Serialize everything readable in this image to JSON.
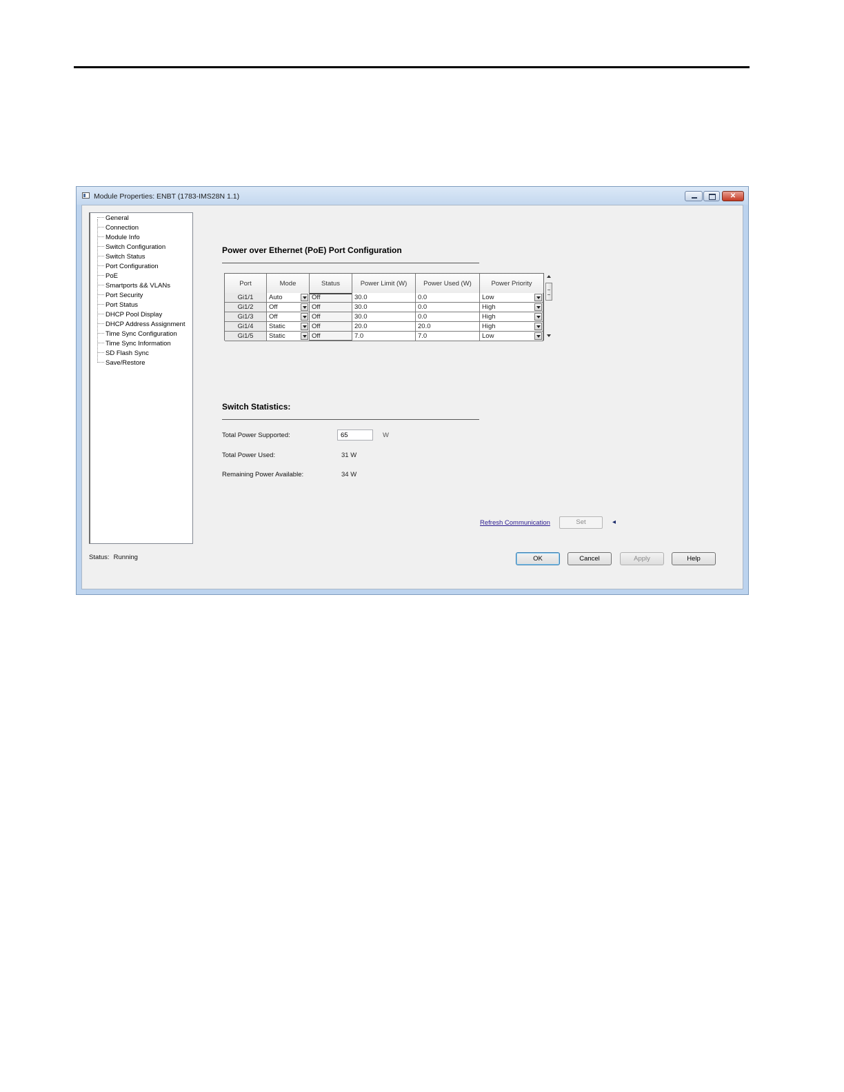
{
  "window": {
    "title": "Module Properties: ENBT (1783-IMS28N 1.1)",
    "close_glyph": "✕"
  },
  "tree": {
    "items": [
      "General",
      "Connection",
      "Module Info",
      "Switch Configuration",
      "Switch Status",
      "Port Configuration",
      "PoE",
      "Smartports && VLANs",
      "Port Security",
      "Port Status",
      "DHCP Pool Display",
      "DHCP Address Assignment",
      "Time Sync Configuration",
      "Time Sync Information",
      "SD Flash Sync",
      "Save/Restore"
    ]
  },
  "poe": {
    "title": "Power over Ethernet (PoE) Port Configuration",
    "columns": [
      "Port",
      "Mode",
      "Status",
      "Power Limit (W)",
      "Power Used (W)",
      "Power Priority"
    ],
    "rows": [
      {
        "port": "Gi1/1",
        "mode": "Auto",
        "status": "Off",
        "limit": "30.0",
        "used": "0.0",
        "priority": "Low"
      },
      {
        "port": "Gi1/2",
        "mode": "Off",
        "status": "Off",
        "limit": "30.0",
        "used": "0.0",
        "priority": "High"
      },
      {
        "port": "Gi1/3",
        "mode": "Off",
        "status": "Off",
        "limit": "30.0",
        "used": "0.0",
        "priority": "High"
      },
      {
        "port": "Gi1/4",
        "mode": "Static",
        "status": "Off",
        "limit": "20.0",
        "used": "20.0",
        "priority": "High"
      },
      {
        "port": "Gi1/5",
        "mode": "Static",
        "status": "Off",
        "limit": "7.0",
        "used": "7.0",
        "priority": "Low"
      }
    ]
  },
  "stats": {
    "title": "Switch Statistics:",
    "total_supported_label": "Total Power Supported:",
    "total_supported_value": "65",
    "total_supported_unit": "W",
    "total_used_label": "Total Power Used:",
    "total_used_value": "31 W",
    "remaining_label": "Remaining Power Available:",
    "remaining_value": "34 W"
  },
  "actions": {
    "refresh_label": "Refresh Communication",
    "set_label": "Set",
    "arrow_glyph": "◂"
  },
  "status": {
    "label": "Status:",
    "value": "Running"
  },
  "buttons": {
    "ok": "OK",
    "cancel": "Cancel",
    "apply": "Apply",
    "help": "Help"
  }
}
